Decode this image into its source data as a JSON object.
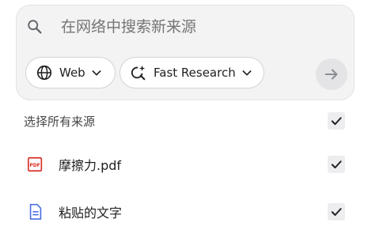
{
  "search": {
    "placeholder": "在网络中搜索新来源",
    "icon": "search-icon"
  },
  "filters": {
    "web": {
      "label": "Web",
      "icon": "globe-icon"
    },
    "research": {
      "label": "Fast Research",
      "icon": "sparkle-search-icon"
    }
  },
  "submit": {
    "icon": "arrow-right-icon"
  },
  "sources": {
    "select_all_label": "选择所有来源",
    "select_all_checked": true,
    "items": [
      {
        "label": "摩擦力.pdf",
        "icon": "pdf-icon",
        "checked": true,
        "color": "#d93025"
      },
      {
        "label": "粘贴的文字",
        "icon": "text-document-icon",
        "checked": true,
        "color": "#4d6fe3"
      }
    ]
  },
  "colors": {
    "card_bg": "#f3f3f4",
    "checkbox_bg": "#ededf0",
    "submit_bg": "#e4e4e7"
  }
}
